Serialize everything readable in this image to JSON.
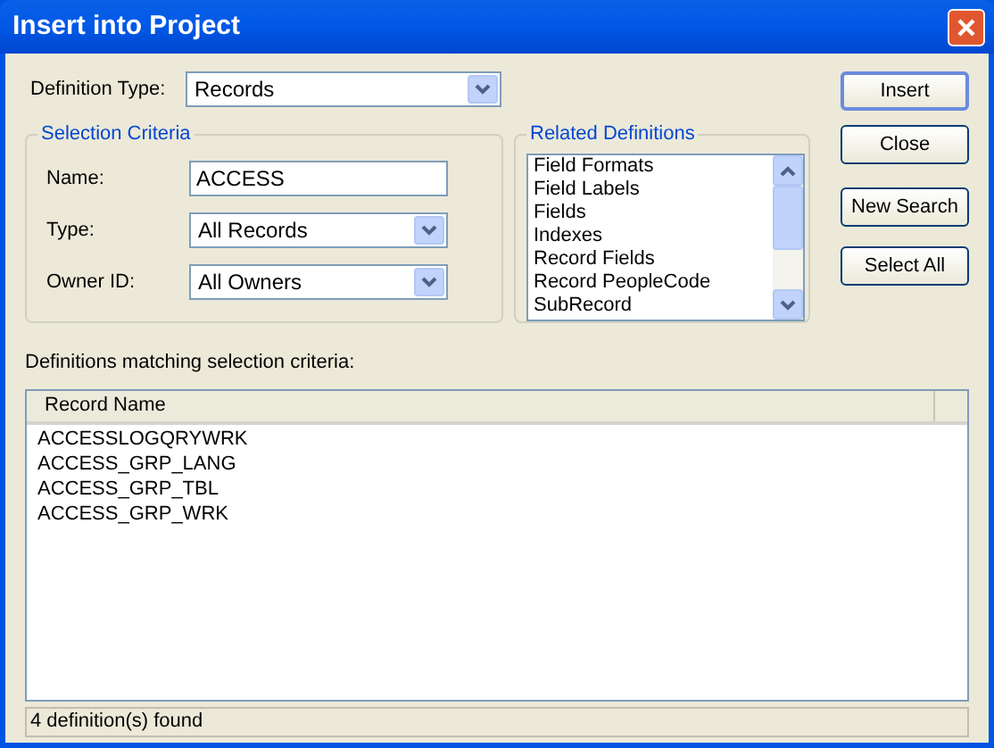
{
  "window": {
    "title": "Insert into Project"
  },
  "definition_type": {
    "label": "Definition Type:",
    "value": "Records"
  },
  "selection_criteria": {
    "title": "Selection Criteria",
    "fields": [
      {
        "kind": "text",
        "label": "Name:",
        "value": "ACCESS"
      },
      {
        "kind": "dropdown",
        "label": "Type:",
        "value": "All Records"
      },
      {
        "kind": "dropdown",
        "label": "Owner ID:",
        "value": "All Owners"
      }
    ]
  },
  "related_definitions": {
    "title": "Related Definitions",
    "items": [
      "Field Formats",
      "Field Labels",
      "Fields",
      "Indexes",
      "Record Fields",
      "Record PeopleCode",
      "SubRecord"
    ]
  },
  "buttons": [
    {
      "label": "Insert",
      "default": true
    },
    {
      "label": "Close",
      "default": false
    },
    {
      "label": "New Search",
      "default": false
    },
    {
      "label": "Select All",
      "default": false
    }
  ],
  "results": {
    "label": "Definitions matching selection criteria:",
    "columns": [
      "Record Name"
    ],
    "rows": [
      "ACCESSLOGQRYWRK",
      "ACCESS_GRP_LANG",
      "ACCESS_GRP_TBL",
      "ACCESS_GRP_WRK"
    ]
  },
  "status_bar": "4 definition(s) found"
}
